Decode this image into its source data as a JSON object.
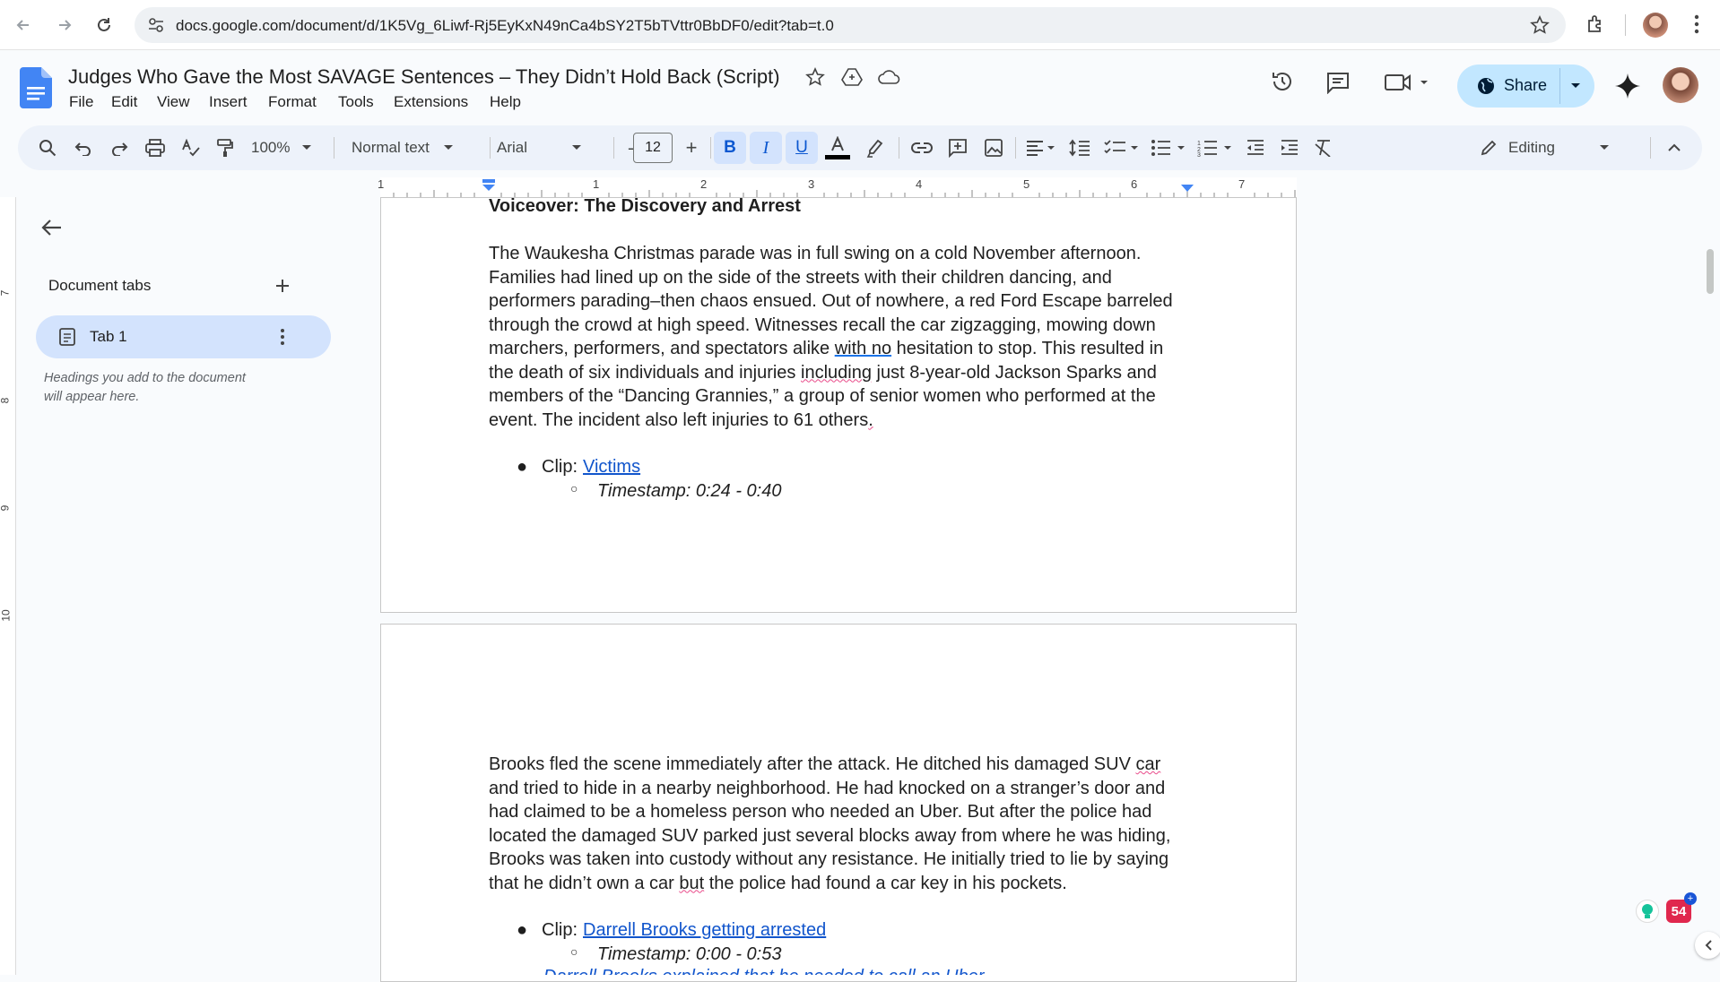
{
  "browser": {
    "url": "docs.google.com/document/d/1K5Vg_6Liwf-Rj5EyKxN49nCa4bSY2T5bTVttr0BbDF0/edit?tab=t.0"
  },
  "doc": {
    "title": "Judges Who Gave the Most SAVAGE Sentences – They Didn’t Hold Back (Script)",
    "share_label": "Share",
    "menu": [
      "File",
      "Edit",
      "View",
      "Insert",
      "Format",
      "Tools",
      "Extensions",
      "Help"
    ]
  },
  "toolbar": {
    "zoom": "100%",
    "style": "Normal text",
    "font": "Arial",
    "font_size": "12",
    "mode": "Editing"
  },
  "ruler": {
    "numbers": [
      "1",
      "1",
      "2",
      "3",
      "4",
      "5",
      "6",
      "7"
    ]
  },
  "vruler": {
    "numbers": [
      "7",
      "8",
      "9",
      "10"
    ]
  },
  "sidebar": {
    "heading": "Document tabs",
    "tab_name": "Tab 1",
    "hint_line1": "Headings you add to the document",
    "hint_line2": "will appear here."
  },
  "page1": {
    "heading": "Voiceover: The Discovery and Arrest",
    "para_lines": [
      "The Waukesha Christmas parade was in full swing on a cold November afternoon.",
      "Families had lined up on the side of the streets with their children dancing, and",
      "performers parading–then chaos ensued. Out of nowhere, a red Ford Escape barreled",
      "through the crowd at high speed. Witnesses recall the car zigzagging, mowing down",
      "marchers, performers, and spectators alike ",
      "with no",
      " hesitation to stop. This resulted in",
      "the death of six individuals and injuries ",
      "including",
      " just 8-year-old Jackson Sparks and",
      "members of the “Dancing Grannies,” a group of senior women who performed at the",
      "event. The incident also left injuries to 61 others",
      "."
    ],
    "clip_prefix": "Clip: ",
    "clip_link": "Victims",
    "timestamp": "Timestamp: 0:24 - 0:40"
  },
  "page2": {
    "para_lines": [
      "Brooks fled the scene immediately after the attack. He ditched his damaged SUV ",
      "car",
      "and tried to hide in a nearby neighborhood. He had knocked on a stranger’s door and",
      "had claimed to be a homeless person who needed an Uber. But after the police had",
      "located the damaged SUV parked just several blocks away from where he was hiding,",
      "Brooks was taken into custody without any resistance. He initially tried to lie by saying",
      "that he didn’t own a car ",
      "but",
      " the police had found a car key in his pockets."
    ],
    "clip_prefix": "Clip: ",
    "clip_link": "Darrell Brooks getting arrested",
    "timestamp": "Timestamp:  0:00 - 0:53",
    "cutoff_link": "Darrell Brooks explained that he needed to call an Uber"
  },
  "badge": {
    "count": "54"
  },
  "colors": {
    "accent": "#1a73e8",
    "share_bg": "#c2e7ff",
    "toolbar_bg": "#edf2fa",
    "tab_active": "#d3e3fd",
    "link": "#1155cc"
  }
}
